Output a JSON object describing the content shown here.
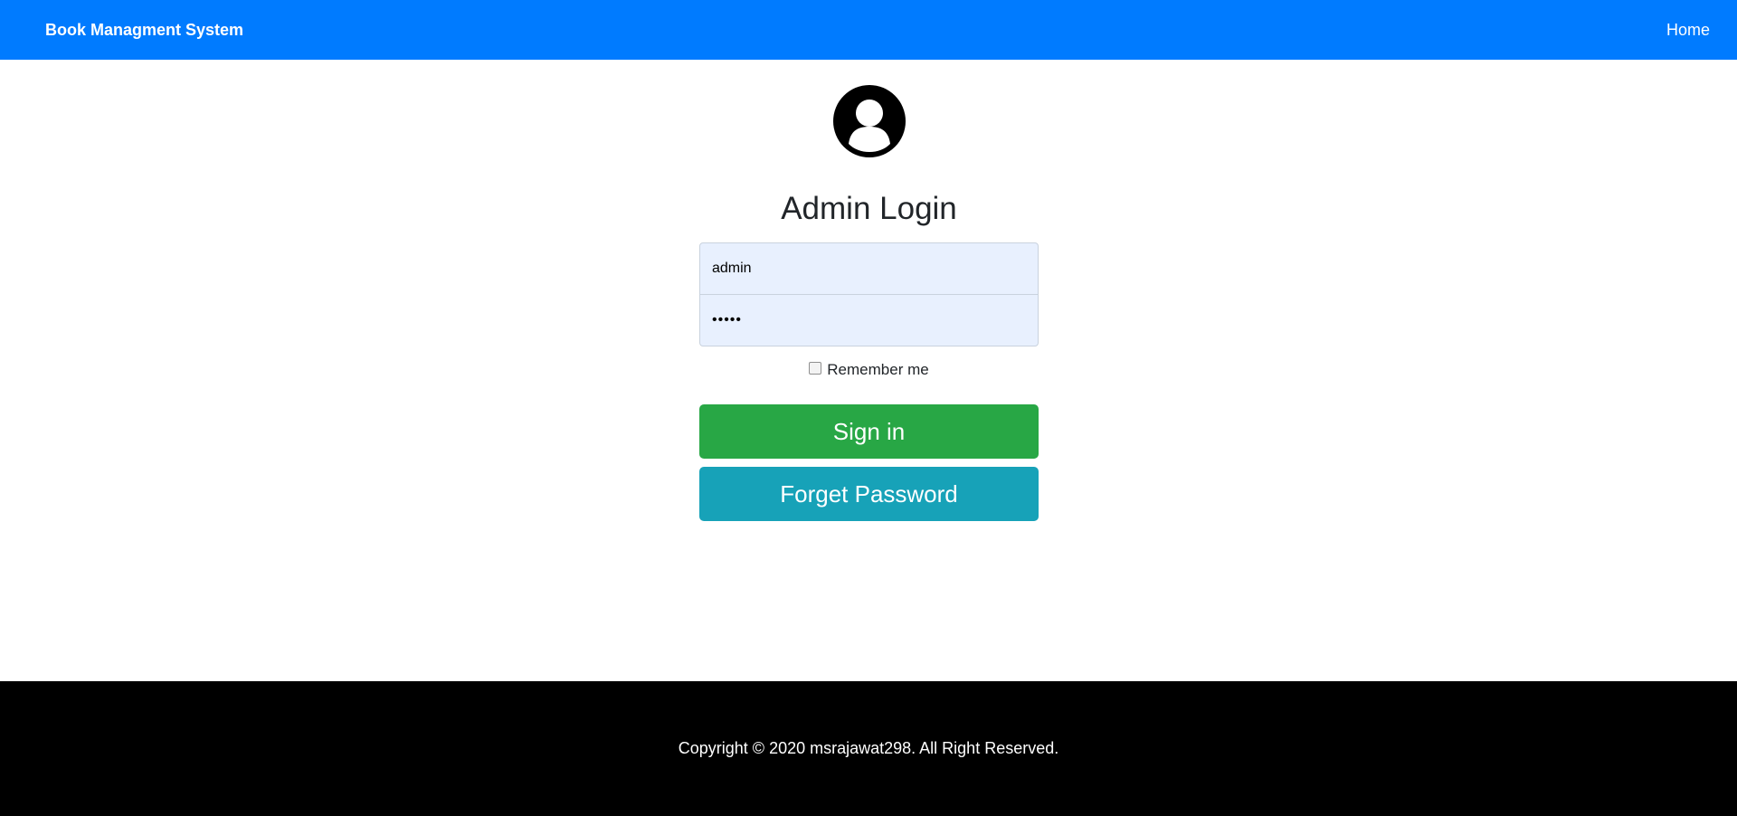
{
  "navbar": {
    "brand": "Book Managment System",
    "home_link": "Home",
    "color": "#007bff"
  },
  "login": {
    "avatar_icon": "user-circle-icon",
    "title": "Admin Login",
    "username": {
      "value": "admin"
    },
    "password": {
      "value": "admin"
    },
    "remember_label": "Remember me",
    "remember_checked": false,
    "signin_label": "Sign in",
    "signin_color": "#28a745",
    "forget_label": "Forget Password",
    "forget_color": "#17a2b8"
  },
  "footer": {
    "text": "Copyright © 2020 msrajawat298. All Right Reserved."
  }
}
